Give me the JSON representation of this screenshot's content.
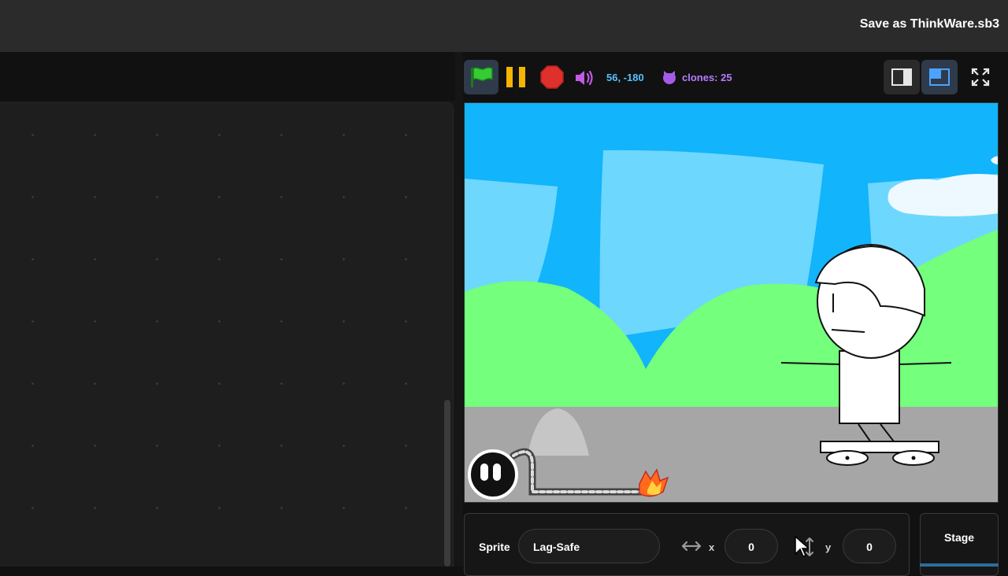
{
  "menubar": {
    "save_label": "Save as ThinkWare.sb3"
  },
  "controls": {
    "flag_icon": "green-flag-icon",
    "pause_icon": "pause-icon",
    "stop_icon": "stop-icon",
    "volume_icon": "volume-icon",
    "mouse_coords": "56, -180",
    "clones_label": "clones: 25"
  },
  "view_buttons": [
    "small-stage-icon",
    "normal-stage-icon",
    "fullscreen-icon"
  ],
  "sprite_info": {
    "label": "Sprite",
    "name": "Lag-Safe",
    "x_label": "x",
    "x_value": "0",
    "y_label": "y",
    "y_value": "0"
  },
  "stage_panel": {
    "label": "Stage"
  },
  "colors": {
    "sky": "#12b4fb",
    "hills": "#74ff7c",
    "ground": "#a6a6a6",
    "coords_text": "#59c0ff",
    "clones_text": "#b77cff",
    "stop": "#e0302b",
    "pause": "#f5b400",
    "flag": "#33cc33"
  }
}
